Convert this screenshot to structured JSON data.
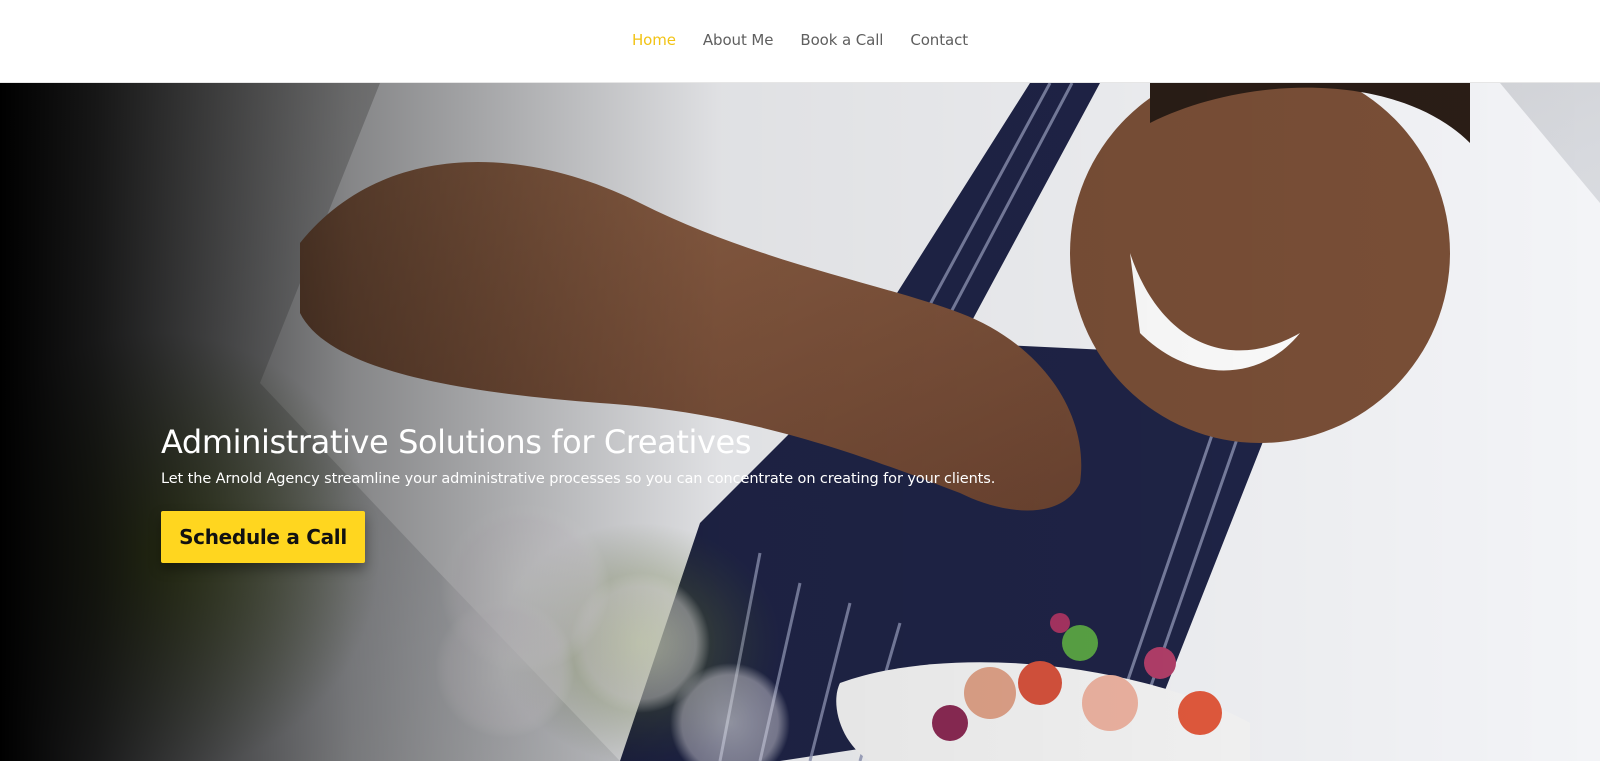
{
  "nav": {
    "items": [
      {
        "label": "Home",
        "active": true
      },
      {
        "label": "About Me",
        "active": false
      },
      {
        "label": "Book a Call",
        "active": false
      },
      {
        "label": "Contact",
        "active": false
      }
    ],
    "active_color": "#f2c315"
  },
  "hero": {
    "title": "Administrative Solutions for Creatives",
    "subtitle": "Let the Arnold Agency streamline your administrative processes so you can concentrate on creating for your clients.",
    "cta_label": "Schedule a Call",
    "cta_color": "#ffd61f",
    "image_subject": "chef-plating-salad-photo"
  }
}
